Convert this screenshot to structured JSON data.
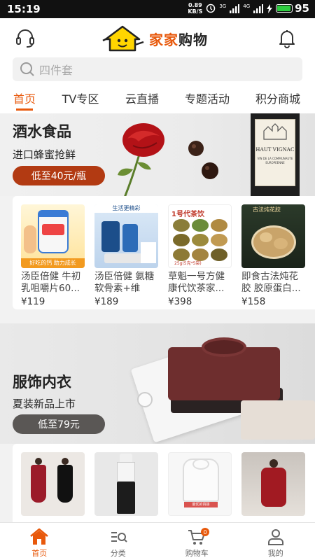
{
  "status_bar": {
    "time": "15:19",
    "net_speed_value": "0.89",
    "net_speed_unit": "KB/S",
    "signal_a": "3G",
    "signal_b": "4G",
    "battery_level": "95",
    "battery_fraction": 0.95
  },
  "header": {
    "left_icon": "headset-icon",
    "logo_text_a": "家家",
    "logo_text_b": "购物",
    "right_icon": "bell-icon"
  },
  "search": {
    "placeholder": "四件套"
  },
  "tabs": [
    {
      "label": "首页",
      "active": true
    },
    {
      "label": "TV专区",
      "active": false
    },
    {
      "label": "云直播",
      "active": false
    },
    {
      "label": "专题活动",
      "active": false
    },
    {
      "label": "积分商城",
      "active": false
    }
  ],
  "sections": [
    {
      "title": "酒水食品",
      "subtitle": "进口蜂蜜抢鲜",
      "button": "低至40元/瓶",
      "wine_label_a": "HAUT VIGNAC",
      "wine_label_b": "VIN DE LA COMMUNAUTE EUROPEENNE",
      "products": [
        {
          "name": "汤臣倍健 牛初乳咀嚼片60...",
          "price": "¥119",
          "img_caption": "好吃的钙 助力成长"
        },
        {
          "name": "汤臣倍健 氨糖软骨素+维生...",
          "price": "¥189",
          "img_caption": "生活更精彩"
        },
        {
          "name": "草魁一号方健康代饮茶家...",
          "price": "¥398",
          "img_caption": "1号代茶饮",
          "img_caption_b": "25g(5克*5袋)"
        },
        {
          "name": "即食古法炖花胶 胶原蛋白...",
          "price": "¥158",
          "img_caption": "古法炖花胶"
        }
      ]
    },
    {
      "title": "服饰内衣",
      "subtitle": "夏装新品上市",
      "button": "低至79元",
      "products": [
        {
          "name": "",
          "price": ""
        },
        {
          "name": "",
          "price": ""
        },
        {
          "name": "",
          "price": "",
          "img_caption": "最优的百搭"
        },
        {
          "name": "",
          "price": ""
        }
      ]
    }
  ],
  "bottom_nav": [
    {
      "label": "首页",
      "icon": "home-icon",
      "active": true
    },
    {
      "label": "分类",
      "icon": "category-icon",
      "active": false
    },
    {
      "label": "购物车",
      "icon": "cart-icon",
      "active": false,
      "badge": "0"
    },
    {
      "label": "我的",
      "icon": "user-icon",
      "active": false
    }
  ],
  "colors": {
    "accent": "#e8590c",
    "food_button": "#b23a12",
    "apparel_button": "#5a5755"
  }
}
